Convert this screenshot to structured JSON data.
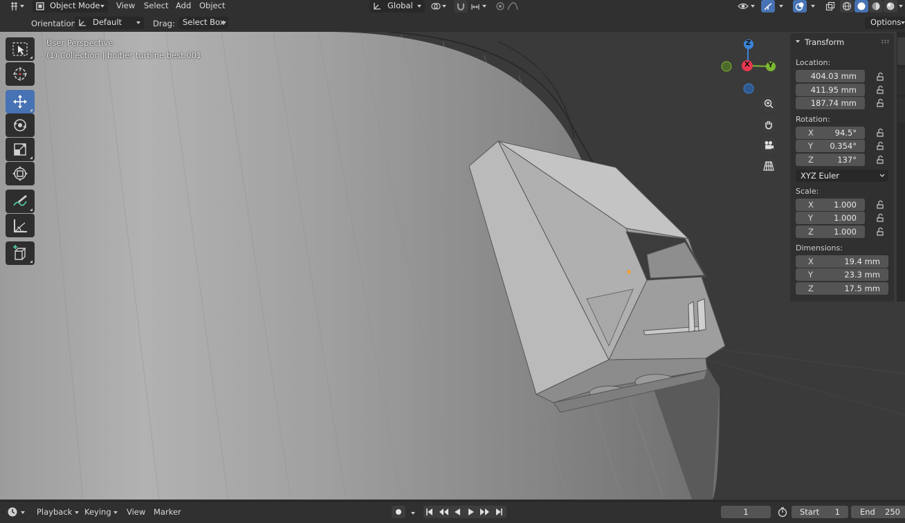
{
  "header": {
    "editor_type_icon": "viewport-editor-icon",
    "mode": "Object Mode",
    "menus": [
      "View",
      "Select",
      "Add",
      "Object"
    ],
    "transform_orientation": "Global"
  },
  "tool_header": {
    "orientation_label": "Orientation:",
    "orientation_value": "Default",
    "drag_label": "Drag:",
    "drag_value": "Select Box",
    "options_label": "Options"
  },
  "viewport": {
    "perspective_label": "User Perspective",
    "collection_label": "(1) Collection | boitier turbine best.001"
  },
  "toolbar": {
    "tools": [
      "select-box",
      "cursor",
      "move",
      "rotate",
      "scale",
      "transform",
      "annotate",
      "measure",
      "add-cube"
    ],
    "active": "move"
  },
  "gizmo": {
    "axes": {
      "x": "X",
      "y": "Y",
      "z": "Z"
    },
    "colors": {
      "x": "#e8384f",
      "y": "#7cb82f",
      "z": "#3b83d8"
    }
  },
  "sidebar": {
    "title": "Transform",
    "location_label": "Location:",
    "location": [
      "404.03 mm",
      "411.95 mm",
      "187.74 mm"
    ],
    "rotation_label": "Rotation:",
    "rotation": [
      {
        "axis": "X",
        "value": "94.5°"
      },
      {
        "axis": "Y",
        "value": "0.354°"
      },
      {
        "axis": "Z",
        "value": "137°"
      }
    ],
    "rotation_mode": "XYZ Euler",
    "scale_label": "Scale:",
    "scale": [
      {
        "axis": "X",
        "value": "1.000"
      },
      {
        "axis": "Y",
        "value": "1.000"
      },
      {
        "axis": "Z",
        "value": "1.000"
      }
    ],
    "dimensions_label": "Dimensions:",
    "dimensions": [
      {
        "axis": "X",
        "value": "19.4 mm"
      },
      {
        "axis": "Y",
        "value": "23.3 mm"
      },
      {
        "axis": "Z",
        "value": "17.5 mm"
      }
    ]
  },
  "timeline": {
    "menus": [
      "Playback",
      "Keying",
      "View",
      "Marker"
    ],
    "current_frame": "1",
    "start_label": "Start",
    "start_value": "1",
    "end_label": "End",
    "end_value": "250"
  },
  "colors": {
    "accent": "#4772b3",
    "header_bg": "#303030",
    "field_bg": "#545454"
  }
}
